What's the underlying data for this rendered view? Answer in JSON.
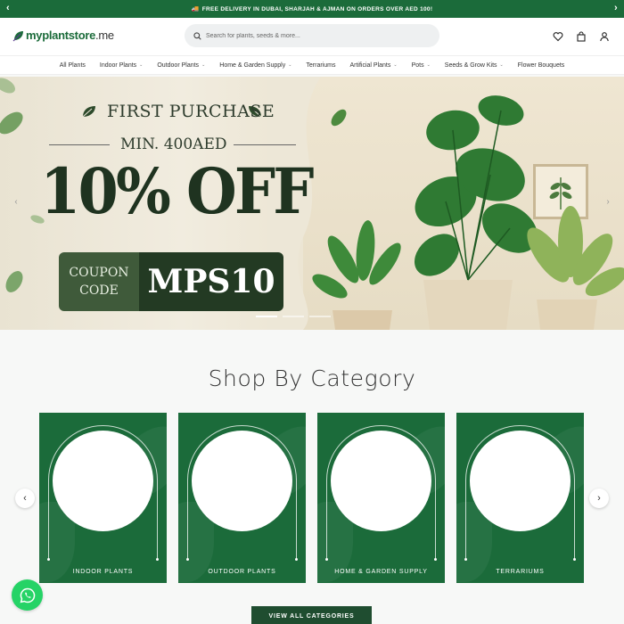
{
  "announcement": {
    "text": "FREE DELIVERY IN DUBAI, SHARJAH & AJMAN ON ORDERS OVER AED 100!",
    "prev": "‹",
    "next": "›"
  },
  "header": {
    "logo_my": "my",
    "logo_main": "plantstore",
    "logo_tld": ".me",
    "search_placeholder": "Search for plants, seeds & more..."
  },
  "nav": {
    "items": [
      {
        "label": "All Plants",
        "dropdown": false
      },
      {
        "label": "Indoor Plants",
        "dropdown": true
      },
      {
        "label": "Outdoor Plants",
        "dropdown": true
      },
      {
        "label": "Home & Garden Supply",
        "dropdown": true
      },
      {
        "label": "Terrariums",
        "dropdown": false
      },
      {
        "label": "Artificial Plants",
        "dropdown": true
      },
      {
        "label": "Pots",
        "dropdown": true
      },
      {
        "label": "Seeds & Grow Kits",
        "dropdown": true
      },
      {
        "label": "Flower Bouquets",
        "dropdown": false
      }
    ],
    "chevron": "⌄"
  },
  "hero": {
    "headline": "FIRST PURCHASE",
    "min": "MIN. 400AED",
    "offer": "10% OFF",
    "coupon_line1": "COUPON",
    "coupon_line2": "CODE",
    "coupon_code": "MPS10",
    "prev": "‹",
    "next": "›"
  },
  "categories": {
    "title": "Shop By Category",
    "items": [
      "INDOOR PLANTS",
      "OUTDOOR PLANTS",
      "HOME & GARDEN SUPPLY",
      "TERRARIUMS"
    ],
    "prev": "‹",
    "next": "›",
    "view_all": "VIEW ALL CATEGORIES"
  },
  "colors": {
    "brand_green": "#1b6b3a",
    "dark_green": "#233a23",
    "whatsapp": "#25d366"
  },
  "icons": [
    "truck-icon",
    "search-icon",
    "heart-icon",
    "bag-icon",
    "user-icon",
    "whatsapp-icon"
  ]
}
